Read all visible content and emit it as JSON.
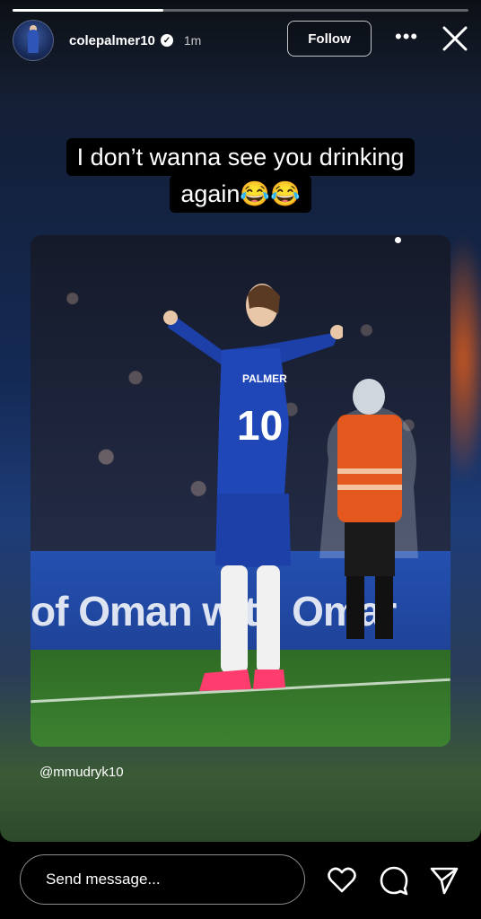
{
  "story": {
    "progress": 0.33,
    "user": {
      "username": "colepalmer10",
      "verified": true,
      "time": "1m"
    },
    "follow_label": "Follow",
    "caption_line1": "I don’t wanna see you drinking",
    "caption_line2": "again😂😂",
    "photo": {
      "board_text": "of Oman with Omar",
      "shirt_name": "PALMER",
      "shirt_number": "10"
    },
    "mention": "@mmudryk10"
  },
  "footer": {
    "message_placeholder": "Send message..."
  },
  "icons": [
    "verified-badge-icon",
    "more-options-icon",
    "close-icon",
    "heart-icon",
    "comment-icon",
    "send-icon"
  ],
  "colors": {
    "accent": "#ffffff",
    "background": "#000000"
  }
}
